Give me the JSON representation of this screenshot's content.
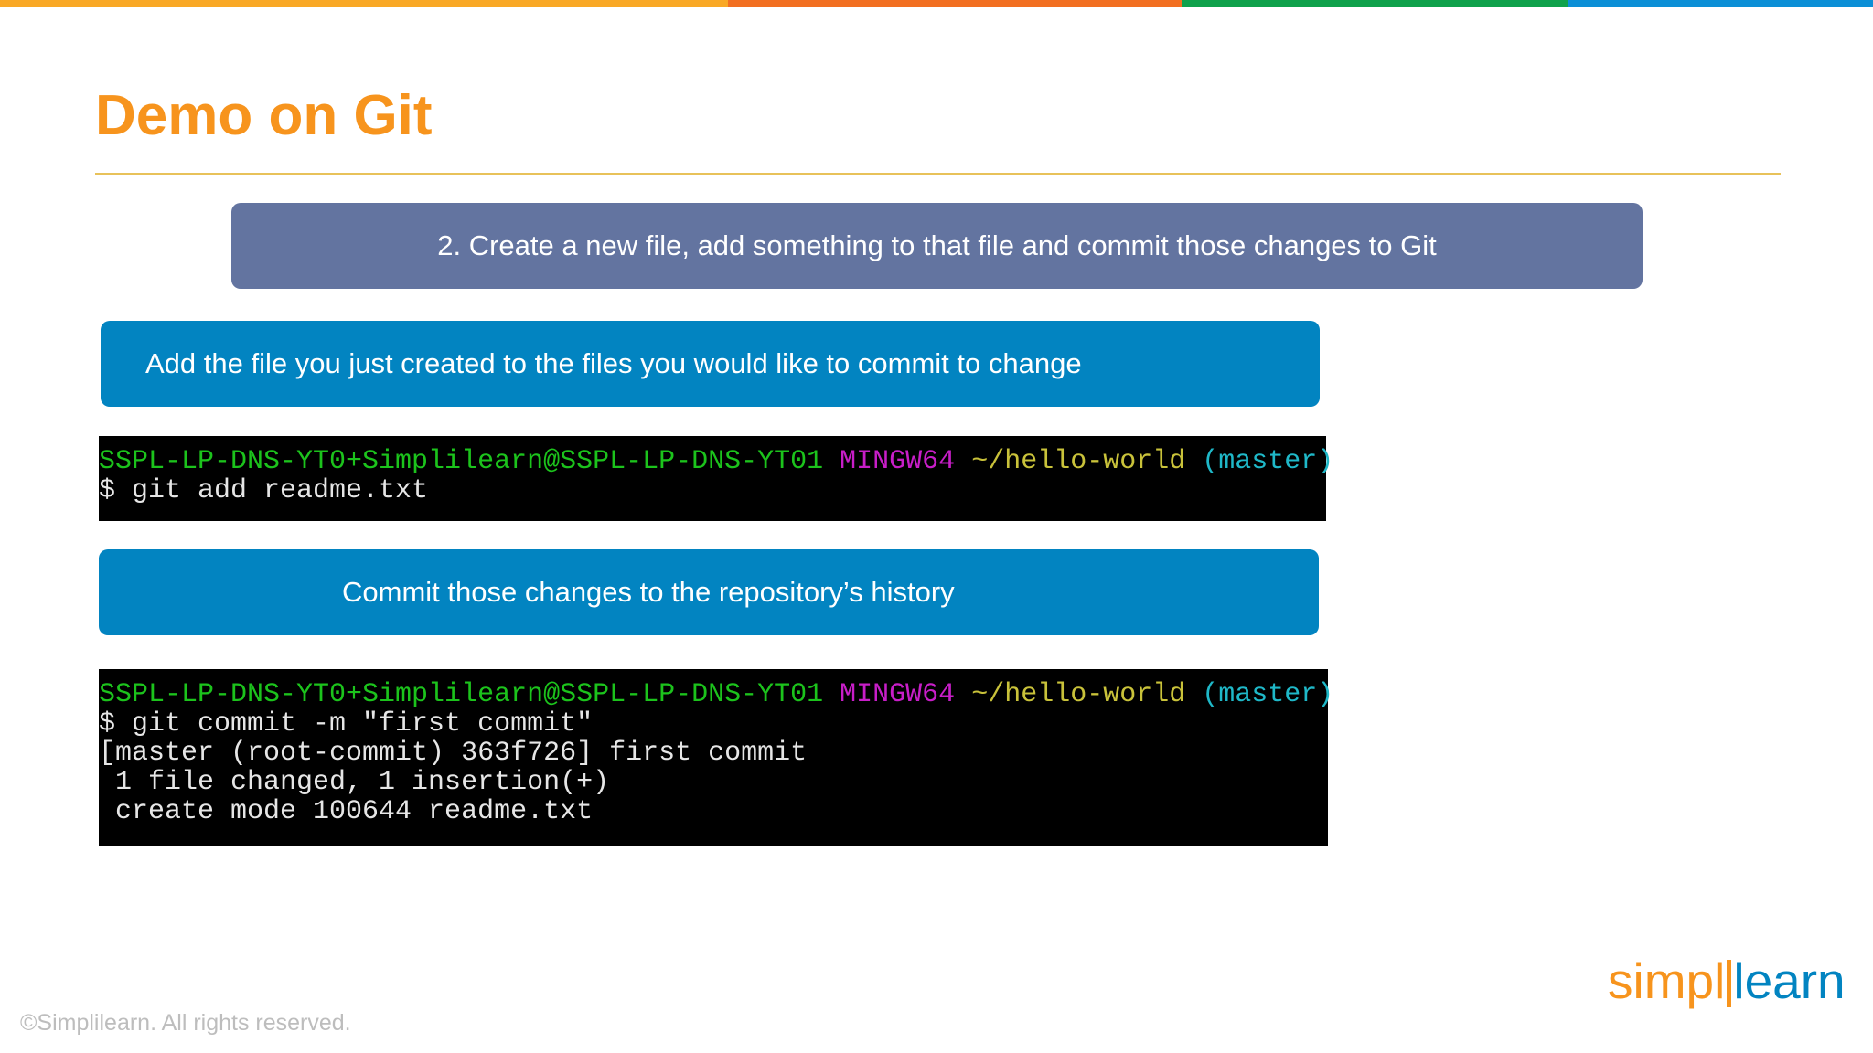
{
  "colors": {
    "accent_orange": "#F7941D",
    "rule_gold": "#E8C25A",
    "step_banner": "#6374A0",
    "instruction_banner": "#0284C1",
    "topbar": [
      "#F9A825",
      "#F26F21",
      "#0FA14B",
      "#0B8FD6"
    ]
  },
  "slide": {
    "title": "Demo on Git",
    "step_text": "2. Create a new file, add something to that file and commit those changes to Git",
    "add_instruction": "Add the file you just created to the files you would like to commit to change",
    "commit_instruction": "Commit those changes to the repository’s history"
  },
  "terminal1": {
    "prompt_user": "SSPL-LP-DNS-YT0+Simplilearn@SSPL-LP-DNS-YT01",
    "prompt_system": "MINGW64",
    "prompt_path": "~/hello-world",
    "prompt_branch": "(master)",
    "command": "$ git add readme.txt"
  },
  "terminal2": {
    "prompt_user": "SSPL-LP-DNS-YT0+Simplilearn@SSPL-LP-DNS-YT01",
    "prompt_system": "MINGW64",
    "prompt_path": "~/hello-world",
    "prompt_branch": "(master)",
    "command": "$ git commit -m \"first commit\"",
    "output": [
      "[master (root-commit) 363f726] first commit",
      " 1 file changed, 1 insertion(+)",
      " create mode 100644 readme.txt"
    ]
  },
  "footer": {
    "copyright": "©Simplilearn. All rights reserved."
  },
  "logo": {
    "part1": "simpl",
    "part2": "learn"
  }
}
